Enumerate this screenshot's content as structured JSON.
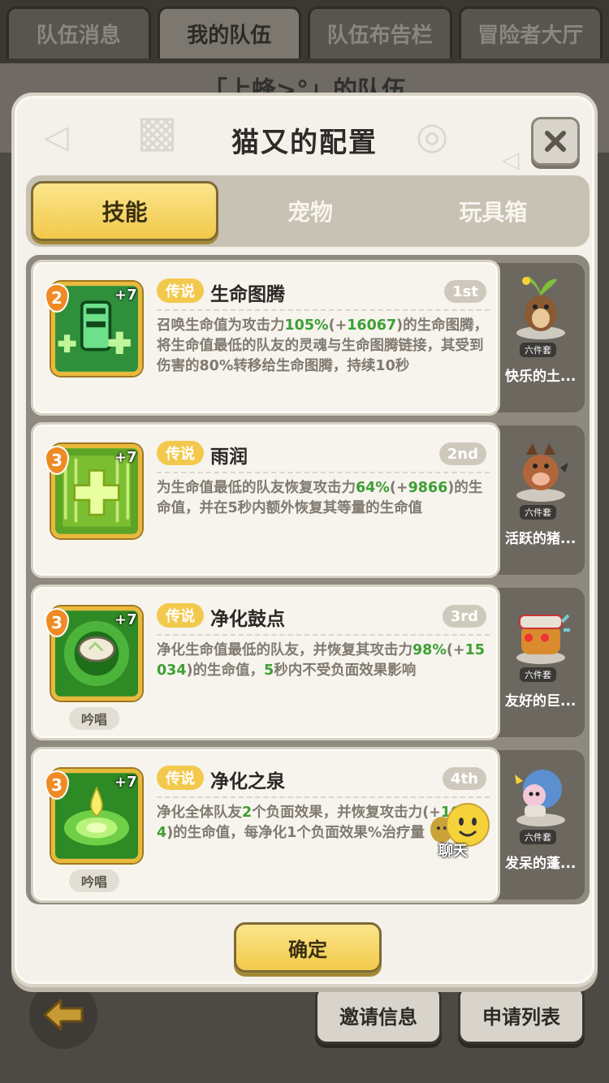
{
  "top_tabs": [
    "队伍消息",
    "我的队伍",
    "队伍布告栏",
    "冒险者大厅"
  ],
  "background_title": "「上蜂>°」的队伍",
  "modal": {
    "title": "猫又的配置",
    "sub_tabs": [
      "技能",
      "宠物",
      "玩具箱"
    ],
    "confirm_label": "确定"
  },
  "skills": [
    {
      "level": "2",
      "plus": "+7",
      "rarity": "传说",
      "name": "生命图腾",
      "order": "1st",
      "desc_parts": [
        "召唤生命值为攻击力",
        "105%",
        "(+",
        "16067",
        ")的生命图腾，将生命值最低的队友的灵魂与生命图腾链接，其受到伤害的80%转移给生命图腾，持续10秒"
      ],
      "chant": ""
    },
    {
      "level": "3",
      "plus": "+7",
      "rarity": "传说",
      "name": "雨润",
      "order": "2nd",
      "desc_parts": [
        "为生命值最低的队友恢复攻击力",
        "64%",
        "(+",
        "9866",
        ")的生命值，并在5秒内额外恢复其等量的生命值"
      ],
      "chant": ""
    },
    {
      "level": "3",
      "plus": "+7",
      "rarity": "传说",
      "name": "净化鼓点",
      "order": "3rd",
      "desc_parts": [
        "净化生命值最低的队友，并恢复其攻击力",
        "98%",
        "(+",
        "15034",
        ")的生命值，",
        "5",
        "秒内不受负面效果影响"
      ],
      "chant": "吟唱"
    },
    {
      "level": "3",
      "plus": "+7",
      "rarity": "传说",
      "name": "净化之泉",
      "order": "4th",
      "desc_parts": [
        "净化全体队友",
        "2",
        "个负面效果，并恢复攻击力",
        "",
        "(+",
        "10524",
        ")的生命值，每净化1个负面效果",
        "",
        "%治疗量"
      ],
      "chant": "吟唱"
    }
  ],
  "side_pets": [
    {
      "badge": "六件套",
      "name": "快乐的土..."
    },
    {
      "badge": "六件套",
      "name": "活跃的猪..."
    },
    {
      "badge": "六件套",
      "name": "友好的巨..."
    },
    {
      "badge": "六件套",
      "name": "发呆的蓬..."
    }
  ],
  "chat_label": "聊天",
  "bottom_buttons": [
    "邀请信息",
    "申请列表"
  ],
  "icons": {
    "close": "close-icon",
    "back": "back-arrow-icon"
  },
  "colors": {
    "accent_gold": "#f2c94b",
    "highlight_green": "#3e9f35",
    "rarity_badge": "#f3c94d",
    "level_badge": "#f08a24"
  }
}
